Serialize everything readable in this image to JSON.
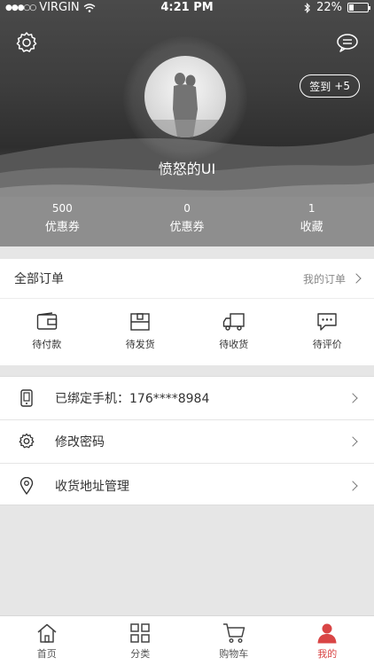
{
  "status_bar": {
    "carrier": "VIRGIN",
    "signal": "●●●○○",
    "time": "4:21 PM",
    "battery": "22%"
  },
  "profile": {
    "username": "愤怒的UI",
    "checkin_label": "签到",
    "checkin_points": "+5"
  },
  "stats": [
    {
      "value": "500",
      "label": "优惠券"
    },
    {
      "value": "0",
      "label": "优惠券"
    },
    {
      "value": "1",
      "label": "收藏"
    }
  ],
  "orders": {
    "title": "全部订单",
    "my_orders_link": "我的订单",
    "items": [
      {
        "label": "待付款",
        "icon": "wallet-icon"
      },
      {
        "label": "待发货",
        "icon": "box-icon"
      },
      {
        "label": "待收货",
        "icon": "truck-icon"
      },
      {
        "label": "待评价",
        "icon": "comment-icon"
      }
    ]
  },
  "settings": [
    {
      "label": "已绑定手机：176****8984",
      "icon": "phone-icon"
    },
    {
      "label": "修改密码",
      "icon": "gear-icon"
    },
    {
      "label": "收货地址管理",
      "icon": "location-pin-icon"
    }
  ],
  "tabbar": [
    {
      "label": "首页",
      "icon": "home-icon",
      "active": false
    },
    {
      "label": "分类",
      "icon": "category-grid-icon",
      "active": false
    },
    {
      "label": "购物车",
      "icon": "cart-icon",
      "active": false
    },
    {
      "label": "我的",
      "icon": "user-icon",
      "active": true
    }
  ],
  "colors": {
    "accent": "#d94545",
    "page_bg": "#e6e6e6"
  }
}
